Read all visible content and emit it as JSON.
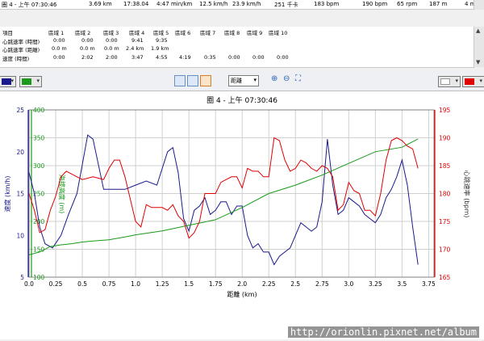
{
  "lap_row": {
    "label": "圈 4 - 上午 07:30:46",
    "values": [
      "3.69 km",
      "17:38.04",
      "4:47 min/km",
      "12.5 km/h",
      "23.9 km/h",
      "251 千卡",
      "183 bpm",
      "190 bpm",
      "65 rpm",
      "187 m",
      "4 m"
    ]
  },
  "zones": {
    "header": [
      "項目",
      "區域 1",
      "區域 2",
      "區域 3",
      "區域 4",
      "區域 5",
      "區域 6",
      "區域 7",
      "區域 8",
      "區域 9",
      "區域 10"
    ],
    "rows": [
      {
        "label": "心跳速率 (時間)",
        "cells": [
          "0:00",
          "0:00",
          "0:00",
          "9:41",
          "9:35"
        ]
      },
      {
        "label": "心跳速率 (距離)",
        "cells": [
          "0.0 m",
          "0.0 m",
          "0.0 m",
          "2.4 km",
          "1.9 km"
        ]
      },
      {
        "label": "速度 (時間)",
        "cells": [
          "0:00",
          "2:02",
          "2:00",
          "3:47",
          "4:55",
          "4:19",
          "0:35",
          "0:00",
          "0:00",
          "0:00"
        ]
      }
    ]
  },
  "toolbar": {
    "left_colors": [
      "#1a1a8c",
      "#1a9a1a"
    ],
    "right_colors": [
      "#ffffff",
      "#e00000"
    ],
    "axis_select": "距離"
  },
  "watermark": "http://orionlin.pixnet.net/album",
  "chart_data": {
    "type": "line",
    "title": "圈 4 - 上午 07:30:46",
    "xlabel": "距離 (km)",
    "xlim": [
      0,
      3.8
    ],
    "xticks": [
      "0.0",
      "0.25",
      "0.5",
      "0.75",
      "1.0",
      "1.25",
      "1.5",
      "1.75",
      "2.0",
      "2.25",
      "2.5",
      "2.75",
      "3.0",
      "3.25",
      "3.5",
      "3.75"
    ],
    "grid": true,
    "axes": {
      "speed": {
        "label": "速度 (km/h)",
        "ylim": [
          5,
          25
        ],
        "ticks": [
          "5",
          "10",
          "15",
          "20",
          "25"
        ],
        "color": "#1a1a8c"
      },
      "elevation": {
        "label": "海拔高度 (m)",
        "ylim": [
          100,
          400
        ],
        "ticks": [
          "100",
          "150",
          "200",
          "250",
          "300",
          "350",
          "400"
        ],
        "color": "#1a9a1a"
      },
      "heart_rate": {
        "label": "心跳速率 (bpm)",
        "ylim": [
          165,
          195
        ],
        "ticks": [
          "165",
          "170",
          "175",
          "180",
          "185",
          "190",
          "195"
        ],
        "color": "#e00000"
      }
    },
    "series": [
      {
        "axis": "speed",
        "color": "#1a1a8c",
        "x": [
          0,
          0.05,
          0.1,
          0.15,
          0.22,
          0.3,
          0.37,
          0.45,
          0.5,
          0.55,
          0.6,
          0.65,
          0.7,
          0.8,
          0.9,
          1.0,
          1.1,
          1.2,
          1.3,
          1.35,
          1.4,
          1.45,
          1.5,
          1.55,
          1.6,
          1.65,
          1.7,
          1.75,
          1.8,
          1.85,
          1.9,
          1.95,
          2.0,
          2.05,
          2.1,
          2.15,
          2.2,
          2.25,
          2.3,
          2.35,
          2.4,
          2.45,
          2.5,
          2.55,
          2.6,
          2.65,
          2.7,
          2.75,
          2.8,
          2.85,
          2.9,
          2.95,
          3.0,
          3.05,
          3.1,
          3.15,
          3.2,
          3.25,
          3.3,
          3.35,
          3.4,
          3.45,
          3.5,
          3.55,
          3.6,
          3.65
        ],
        "y": [
          17.5,
          15,
          11,
          9,
          8.5,
          10,
          12.5,
          15,
          18.5,
          22,
          21.5,
          18.5,
          15.5,
          15.5,
          15.5,
          16,
          16.5,
          16,
          20,
          20.5,
          17.5,
          12,
          10.5,
          13,
          13.5,
          14.5,
          12.5,
          13,
          14,
          14,
          12.5,
          13.5,
          13.5,
          10,
          8.5,
          9,
          8,
          8,
          6.5,
          7.5,
          8,
          8.5,
          10,
          11.5,
          11,
          10.5,
          11,
          14,
          21.5,
          16,
          12.5,
          13,
          14.5,
          14,
          13.5,
          12.5,
          12,
          11.5,
          12.5,
          14.5,
          15.5,
          17,
          19,
          16,
          11,
          6.5
        ]
      },
      {
        "axis": "elevation",
        "color": "#1a9a1a",
        "x": [
          0,
          0.1,
          0.2,
          0.3,
          0.4,
          0.5,
          0.6,
          0.75,
          0.9,
          1.0,
          1.25,
          1.5,
          1.75,
          2.0,
          2.25,
          2.5,
          2.75,
          3.0,
          3.25,
          3.5,
          3.65
        ],
        "y": [
          140,
          145,
          155,
          158,
          160,
          163,
          165,
          167,
          172,
          176,
          183,
          193,
          203,
          225,
          250,
          265,
          283,
          304,
          325,
          333,
          348
        ]
      },
      {
        "axis": "heart_rate",
        "color": "#e00000",
        "x": [
          0,
          0.05,
          0.1,
          0.15,
          0.2,
          0.25,
          0.3,
          0.35,
          0.4,
          0.45,
          0.5,
          0.6,
          0.7,
          0.75,
          0.8,
          0.85,
          0.9,
          1.0,
          1.05,
          1.1,
          1.15,
          1.2,
          1.25,
          1.3,
          1.35,
          1.4,
          1.45,
          1.5,
          1.55,
          1.6,
          1.65,
          1.7,
          1.75,
          1.8,
          1.85,
          1.9,
          1.95,
          2.0,
          2.05,
          2.1,
          2.15,
          2.2,
          2.25,
          2.3,
          2.35,
          2.4,
          2.45,
          2.5,
          2.55,
          2.6,
          2.65,
          2.7,
          2.75,
          2.8,
          2.85,
          2.9,
          2.95,
          3.0,
          3.05,
          3.1,
          3.15,
          3.2,
          3.25,
          3.3,
          3.35,
          3.4,
          3.45,
          3.5,
          3.55,
          3.6,
          3.65
        ],
        "y": [
          180,
          177,
          173,
          173.5,
          177,
          179.5,
          183,
          184,
          183.5,
          183,
          182.5,
          183,
          182.5,
          184.5,
          186,
          186,
          183,
          175,
          174,
          178,
          177.5,
          177.5,
          177.5,
          177,
          178,
          176,
          175,
          172,
          173,
          175,
          180,
          180,
          180,
          182,
          182.5,
          183,
          183,
          181,
          184.5,
          184,
          184,
          183,
          183,
          190,
          189.5,
          186,
          184,
          184.5,
          186,
          185.5,
          184.5,
          184,
          185,
          184.5,
          183,
          177,
          178,
          182,
          180.5,
          180,
          177,
          177,
          176,
          180,
          186,
          189.5,
          190,
          189.5,
          188.5,
          188,
          184.5
        ]
      }
    ]
  }
}
